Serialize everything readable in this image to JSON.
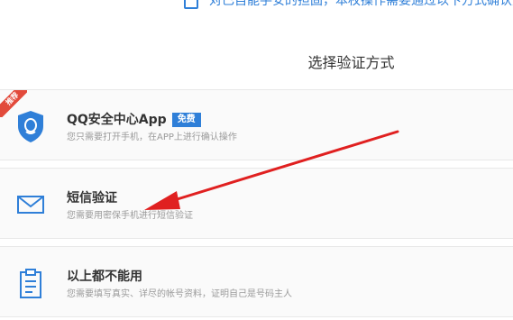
{
  "banner": {
    "text": "对已自能手安的担固，本权操作需要通过以卞方式确认身份"
  },
  "title": "选择验证方式",
  "options": [
    {
      "title": "QQ安全中心App",
      "badge": "免费",
      "ribbon": "推荐",
      "desc": "您只需要打开手机，在APP上进行确认操作",
      "icon": "qq-security-shield-icon"
    },
    {
      "title": "短信验证",
      "desc": "您需要用密保手机进行短信验证",
      "icon": "envelope-icon"
    },
    {
      "title": "以上都不能用",
      "desc": "您需要填写真实、详尽的帐号资料，证明自己是号码主人",
      "icon": "clipboard-icon"
    }
  ],
  "annotation": {
    "arrow_color": "#e02020"
  }
}
